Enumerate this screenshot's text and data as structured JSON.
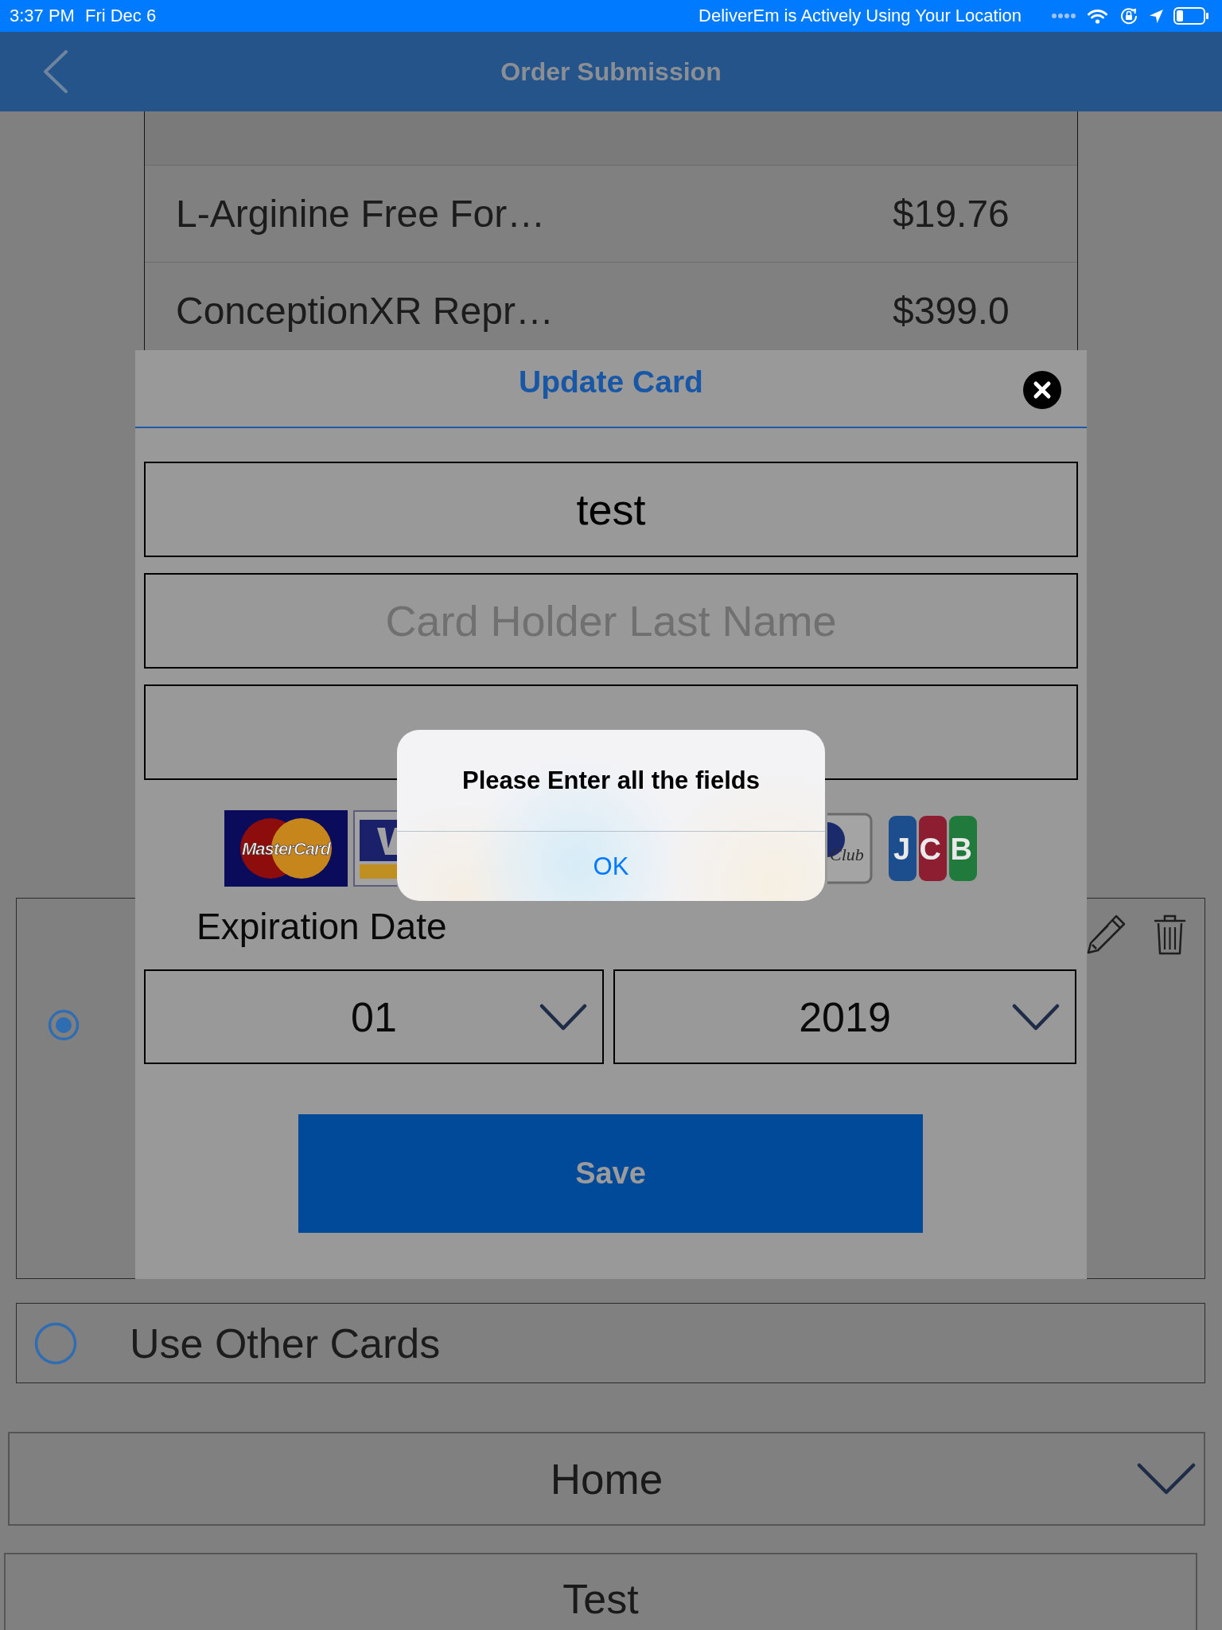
{
  "status_bar": {
    "time": "3:37 PM",
    "date": "Fri Dec 6",
    "notice": "DeliverEm is Actively Using Your Location"
  },
  "nav_bar": {
    "title": "Order Submission"
  },
  "order_table": {
    "rows": [
      {
        "item": "L-Arginine Free For…",
        "price": "$19.76"
      },
      {
        "item": "ConceptionXR Repr…",
        "price": "$399.0"
      }
    ]
  },
  "update_card_dialog": {
    "title": "Update Card",
    "fields": [
      {
        "value": "test"
      },
      {
        "placeholder": "Card Holder Last Name"
      }
    ],
    "card_logos": [
      {
        "kind": "mastercard",
        "text": "MasterCard"
      },
      {
        "kind": "visa"
      },
      {
        "kind": "diners",
        "text": "Club"
      },
      {
        "kind": "jcb",
        "text": "JCB"
      }
    ],
    "expiration": {
      "label": "Expiration Date",
      "month": "01",
      "year": "2019"
    },
    "save_button": "Save"
  },
  "alert": {
    "message": "Please Enter all the fields",
    "button": "OK"
  },
  "payment_options": [
    {
      "kind": "saved_card",
      "selected": true
    },
    {
      "kind": "other_cards",
      "label": "Use Other Cards",
      "selected": false
    }
  ],
  "address_dropdown": {
    "value": "Home"
  },
  "name_field": {
    "value": "Test"
  }
}
